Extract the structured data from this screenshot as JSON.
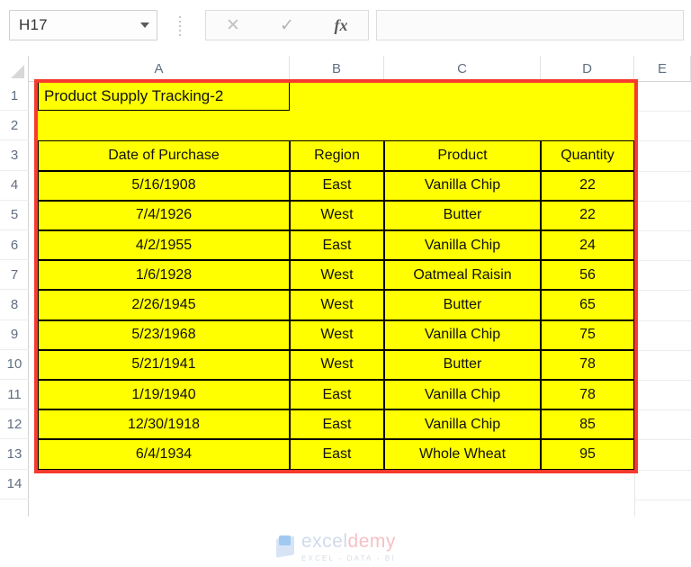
{
  "app": {
    "type": "spreadsheet"
  },
  "formula_bar": {
    "name_box_value": "H17",
    "name_box_dropdown_icon": "chevron-down-icon",
    "cancel_icon": "✕",
    "accept_icon": "✓",
    "function_icon": "fx",
    "formula_value": "",
    "formula_placeholder": ""
  },
  "grid": {
    "column_headers": [
      "A",
      "B",
      "C",
      "D",
      "E"
    ],
    "row_headers": [
      "1",
      "2",
      "3",
      "4",
      "5",
      "6",
      "7",
      "8",
      "9",
      "10",
      "11",
      "12",
      "13",
      "14"
    ],
    "select_all_icon": "select-all-triangle-icon"
  },
  "sheet": {
    "title": "Product Supply Tracking-2",
    "highlight_color": "#FFFF00",
    "outline_color": "#F63A2E",
    "table": {
      "headers": [
        "Date of Purchase",
        "Region",
        "Product",
        "Quantity"
      ],
      "rows": [
        [
          "5/16/1908",
          "East",
          "Vanilla Chip",
          "22"
        ],
        [
          "7/4/1926",
          "West",
          "Butter",
          "22"
        ],
        [
          "4/2/1955",
          "East",
          "Vanilla Chip",
          "24"
        ],
        [
          "1/6/1928",
          "West",
          "Oatmeal Raisin",
          "56"
        ],
        [
          "2/26/1945",
          "West",
          "Butter",
          "65"
        ],
        [
          "5/23/1968",
          "West",
          "Vanilla Chip",
          "75"
        ],
        [
          "5/21/1941",
          "West",
          "Butter",
          "78"
        ],
        [
          "1/19/1940",
          "East",
          "Vanilla Chip",
          "78"
        ],
        [
          "12/30/1918",
          "East",
          "Vanilla Chip",
          "85"
        ],
        [
          "6/4/1934",
          "East",
          "Whole Wheat",
          "95"
        ]
      ]
    }
  },
  "watermark": {
    "name_prefix": "excel",
    "name_suffix": "demy",
    "tagline": "EXCEL - DATA - BI"
  }
}
